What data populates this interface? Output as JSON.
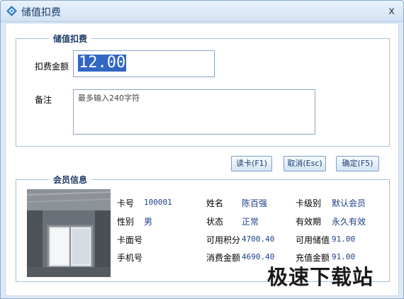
{
  "window": {
    "title": "储值扣费",
    "close_glyph": "x"
  },
  "deduct_group": {
    "legend": "储值扣费",
    "amount_label": "扣费金额",
    "amount_value": "12.00",
    "remark_label": "备注",
    "remark_placeholder": "最多输入240字符"
  },
  "buttons": {
    "read_card": "读卡(F1)",
    "cancel": "取消(Esc)",
    "confirm": "确定(F5)"
  },
  "member_group": {
    "legend": "会员信息",
    "fields": {
      "card_no_label": "卡号",
      "card_no": "100001",
      "name_label": "姓名",
      "name": "陈百强",
      "level_label": "卡级别",
      "level": "默认会员",
      "gender_label": "性别",
      "gender": "男",
      "status_label": "状态",
      "status": "正常",
      "validity_label": "有效期",
      "validity": "永久有效",
      "face_no_label": "卡面号",
      "face_no": "",
      "points_label": "可用积分",
      "points": "4700.40",
      "balance_label": "可用储值",
      "balance": "91.00",
      "phone_label": "手机号",
      "phone": "",
      "spent_label": "消费金额",
      "spent": "4690.40",
      "recharge_label": "充值金额",
      "recharge": "91.00"
    }
  },
  "watermark": "极速下载站",
  "colors": {
    "accent": "#3166c5",
    "value_text": "#1e3f86",
    "title_bg": "#dfeaf6"
  }
}
